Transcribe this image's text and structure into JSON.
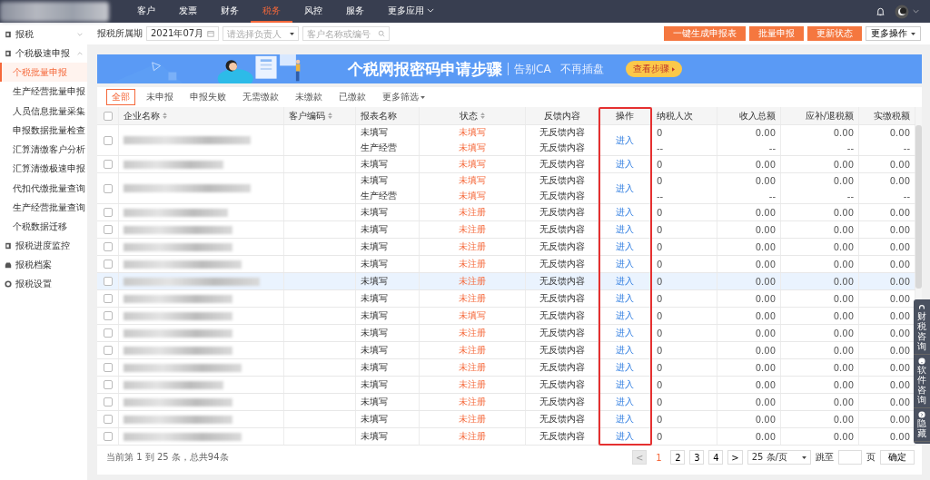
{
  "nav": {
    "items": [
      {
        "label": "客户",
        "selected": false
      },
      {
        "label": "发票",
        "selected": false
      },
      {
        "label": "财务",
        "selected": false
      },
      {
        "label": "税务",
        "selected": true
      },
      {
        "label": "风控",
        "selected": false
      },
      {
        "label": "服务",
        "selected": false
      },
      {
        "label": "更多应用",
        "selected": false,
        "dropdown": true
      }
    ]
  },
  "sidebar": {
    "items": [
      {
        "label": "报税",
        "expanded": false
      },
      {
        "label": "个税极速申报",
        "expanded": true,
        "children": [
          {
            "label": "个税批量申报",
            "selected": true
          },
          {
            "label": "生产经营批量申报",
            "selected": false
          },
          {
            "label": "人员信息批量采集",
            "selected": false
          },
          {
            "label": "申报数据批量检查",
            "selected": false
          },
          {
            "label": "汇算清缴客户分析",
            "selected": false
          },
          {
            "label": "汇算清缴极速申报",
            "selected": false
          },
          {
            "label": "代扣代缴批量查询",
            "selected": false
          },
          {
            "label": "生产经营批量查询",
            "selected": false
          },
          {
            "label": "个税数据迁移",
            "selected": false
          }
        ]
      },
      {
        "label": "报税进度监控"
      },
      {
        "label": "报税档案"
      },
      {
        "label": "报税设置"
      }
    ]
  },
  "toolbar": {
    "period_label": "报税所属期",
    "period_value": "2021年07月",
    "owner_placeholder": "请选择负责人",
    "search_placeholder": "客户名称或编号",
    "buttons": [
      "一键生成申报表",
      "批量申报",
      "更新状态"
    ],
    "more_button": "更多操作"
  },
  "banner": {
    "title": "个税网报密码申请步骤",
    "subtitle_1": "告别CA",
    "subtitle_2": "不再插盘",
    "button": "查看步骤"
  },
  "filters": [
    {
      "label": "全部",
      "selected": true
    },
    {
      "label": "未申报",
      "selected": false
    },
    {
      "label": "申报失败",
      "selected": false
    },
    {
      "label": "无需缴款",
      "selected": false
    },
    {
      "label": "未缴款",
      "selected": false
    },
    {
      "label": "已缴款",
      "selected": false
    },
    {
      "label": "更多筛选",
      "selected": false,
      "dropdown": true
    }
  ],
  "table": {
    "all_checked": false,
    "columns": [
      {
        "label": "企业名称",
        "sortable": true
      },
      {
        "label": "客户编码",
        "sortable": true
      },
      {
        "label": "报表名称",
        "sortable": false
      },
      {
        "label": "状态",
        "sortable": true
      },
      {
        "label": "反馈内容",
        "sortable": false
      },
      {
        "label": "操作",
        "sortable": false,
        "outlined": true
      },
      {
        "label": "纳税人次",
        "sortable": false
      },
      {
        "label": "收入总额",
        "sortable": false
      },
      {
        "label": "应补/退税额",
        "sortable": false
      },
      {
        "label": "实缴税额",
        "sortable": false
      }
    ],
    "rows": [
      {
        "checked": false,
        "highlighted": false,
        "action": "进入",
        "lines": [
          [
            "未填写",
            "未填写",
            "无反馈内容",
            "0",
            "0.00",
            "0.00",
            "0.00"
          ],
          [
            "生产经营",
            "未填写",
            "无反馈内容",
            "--",
            "--",
            "--",
            "--"
          ]
        ]
      },
      {
        "checked": false,
        "highlighted": false,
        "action": "进入",
        "lines": [
          [
            "未填写",
            "未填写",
            "无反馈内容",
            "0",
            "0.00",
            "0.00",
            "0.00"
          ]
        ]
      },
      {
        "checked": false,
        "highlighted": false,
        "action": "进入",
        "lines": [
          [
            "未填写",
            "未填写",
            "无反馈内容",
            "0",
            "0.00",
            "0.00",
            "0.00"
          ],
          [
            "生产经营",
            "未填写",
            "无反馈内容",
            "--",
            "--",
            "--",
            "--"
          ]
        ]
      },
      {
        "checked": false,
        "highlighted": false,
        "action": "进入",
        "lines": [
          [
            "未填写",
            "未注册",
            "无反馈内容",
            "0",
            "0.00",
            "0.00",
            "0.00"
          ]
        ]
      },
      {
        "checked": false,
        "highlighted": false,
        "action": "进入",
        "lines": [
          [
            "未填写",
            "未注册",
            "无反馈内容",
            "0",
            "0.00",
            "0.00",
            "0.00"
          ]
        ]
      },
      {
        "checked": false,
        "highlighted": false,
        "action": "进入",
        "lines": [
          [
            "未填写",
            "未注册",
            "无反馈内容",
            "0",
            "0.00",
            "0.00",
            "0.00"
          ]
        ]
      },
      {
        "checked": false,
        "highlighted": false,
        "action": "进入",
        "lines": [
          [
            "未填写",
            "未注册",
            "无反馈内容",
            "0",
            "0.00",
            "0.00",
            "0.00"
          ]
        ]
      },
      {
        "checked": false,
        "highlighted": true,
        "action": "进入",
        "lines": [
          [
            "未填写",
            "未注册",
            "无反馈内容",
            "0",
            "0.00",
            "0.00",
            "0.00"
          ]
        ]
      },
      {
        "checked": false,
        "highlighted": false,
        "action": "进入",
        "lines": [
          [
            "未填写",
            "未注册",
            "无反馈内容",
            "0",
            "0.00",
            "0.00",
            "0.00"
          ]
        ]
      },
      {
        "checked": false,
        "highlighted": false,
        "action": "进入",
        "lines": [
          [
            "未填写",
            "未填写",
            "无反馈内容",
            "0",
            "0.00",
            "0.00",
            "0.00"
          ]
        ]
      },
      {
        "checked": false,
        "highlighted": false,
        "action": "进入",
        "lines": [
          [
            "未填写",
            "未注册",
            "无反馈内容",
            "0",
            "0.00",
            "0.00",
            "0.00"
          ]
        ]
      },
      {
        "checked": false,
        "highlighted": false,
        "action": "进入",
        "lines": [
          [
            "未填写",
            "未注册",
            "无反馈内容",
            "0",
            "0.00",
            "0.00",
            "0.00"
          ]
        ]
      },
      {
        "checked": false,
        "highlighted": false,
        "action": "进入",
        "lines": [
          [
            "未填写",
            "未注册",
            "无反馈内容",
            "0",
            "0.00",
            "0.00",
            "0.00"
          ]
        ]
      },
      {
        "checked": false,
        "highlighted": false,
        "action": "进入",
        "lines": [
          [
            "未填写",
            "未注册",
            "无反馈内容",
            "0",
            "0.00",
            "0.00",
            "0.00"
          ]
        ]
      },
      {
        "checked": false,
        "highlighted": false,
        "action": "进入",
        "lines": [
          [
            "未填写",
            "未注册",
            "无反馈内容",
            "0",
            "0.00",
            "0.00",
            "0.00"
          ]
        ]
      },
      {
        "checked": false,
        "highlighted": false,
        "action": "进入",
        "lines": [
          [
            "未填写",
            "未注册",
            "无反馈内容",
            "0",
            "0.00",
            "0.00",
            "0.00"
          ]
        ]
      },
      {
        "checked": false,
        "highlighted": false,
        "action": "进入",
        "lines": [
          [
            "未填写",
            "未注册",
            "无反馈内容",
            "0",
            "0.00",
            "0.00",
            "0.00"
          ]
        ]
      }
    ]
  },
  "pagination": {
    "summary": "当前第 1 到 25 条，总共94条",
    "prev": "<",
    "pages": [
      {
        "label": "1",
        "selected": true
      },
      {
        "label": "2",
        "selected": false
      },
      {
        "label": "3",
        "selected": false
      },
      {
        "label": "4",
        "selected": false
      }
    ],
    "next": ">",
    "page_size": "25 条/页",
    "jump_label": "跳至",
    "page_unit": "页",
    "confirm": "确定"
  },
  "float_panel": [
    {
      "label": "财税咨询",
      "kind": "headset"
    },
    {
      "label": "软件咨询",
      "kind": "question"
    },
    {
      "label": "隐藏",
      "kind": "arrow"
    }
  ]
}
